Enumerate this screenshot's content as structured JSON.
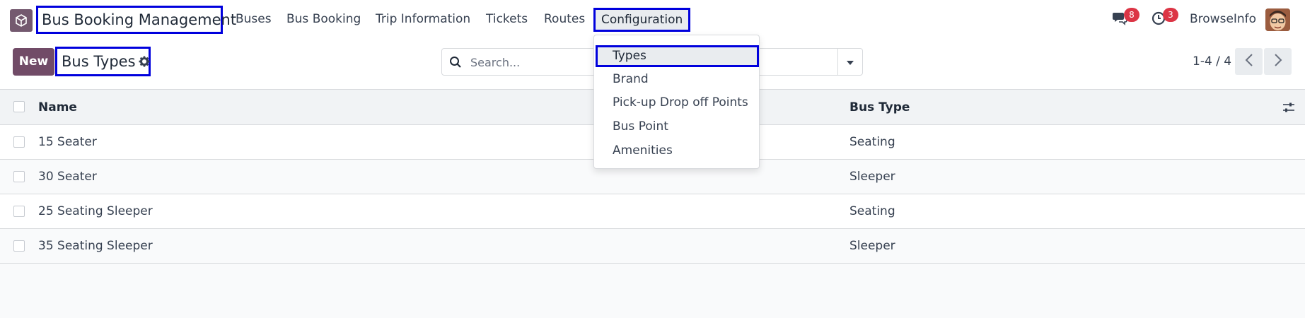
{
  "navbar": {
    "app_title": "Bus Booking Management",
    "menu": [
      {
        "label": "Buses"
      },
      {
        "label": "Bus Booking"
      },
      {
        "label": "Trip Information"
      },
      {
        "label": "Tickets"
      },
      {
        "label": "Routes"
      },
      {
        "label": "Configuration"
      }
    ],
    "messages_count": "8",
    "activities_count": "3",
    "company": "BrowseInfo"
  },
  "control": {
    "new_label": "New",
    "breadcrumb": "Bus Types",
    "search_placeholder": "Search...",
    "pager": "1-4 / 4"
  },
  "config_menu": {
    "items": [
      "Types",
      "Brand",
      "Pick-up Drop off Points",
      "Bus Point",
      "Amenities"
    ]
  },
  "table": {
    "columns": [
      "Name",
      "Bus Type"
    ],
    "rows": [
      {
        "name": "15 Seater",
        "bus_type": "Seating"
      },
      {
        "name": "30 Seater",
        "bus_type": "Sleeper"
      },
      {
        "name": "25 Seating Sleeper",
        "bus_type": "Seating"
      },
      {
        "name": "35 Seating Sleeper",
        "bus_type": "Sleeper"
      }
    ]
  },
  "colors": {
    "brand": "#714b67",
    "highlight_border": "#0000dd",
    "badge": "#dc3545"
  },
  "icons": [
    "app-cube-icon",
    "chat-icon",
    "clock-icon",
    "gear-icon",
    "search-icon",
    "caret-down-icon",
    "chevron-left-icon",
    "chevron-right-icon",
    "column-settings-icon"
  ]
}
